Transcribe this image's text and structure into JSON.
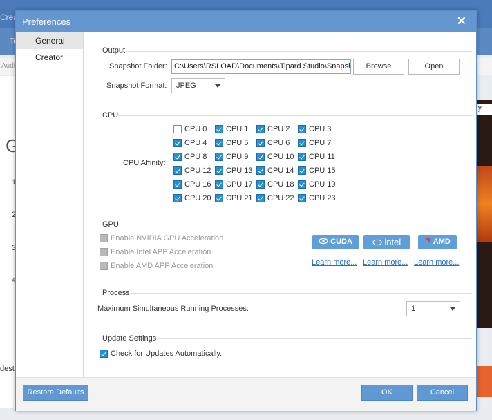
{
  "background": {
    "app_title_fragment": "Crea",
    "tab_fragment": "To",
    "toolbar_fragment": "Audi",
    "big_letter": "G",
    "list_numbers": [
      "1",
      "2",
      "3",
      "4"
    ],
    "right_fragment": "ry",
    "bottom_fragment": "desti"
  },
  "dialog": {
    "title": "Preferences",
    "close_glyph": "✕",
    "sidebar": [
      {
        "label": "General",
        "active": true
      },
      {
        "label": "Creator",
        "active": false
      }
    ],
    "output": {
      "section_title": "Output",
      "snapshot_folder_label": "Snapshot Folder:",
      "snapshot_folder_value": "C:\\Users\\RSLOAD\\Documents\\Tipard Studio\\Snapshot",
      "browse_label": "Browse",
      "open_label": "Open",
      "snapshot_format_label": "Snapshot Format:",
      "snapshot_format_value": "JPEG"
    },
    "cpu": {
      "section_title": "CPU",
      "affinity_label": "CPU Affinity:",
      "items": [
        {
          "label": "CPU 0",
          "checked": false
        },
        {
          "label": "CPU 1",
          "checked": true
        },
        {
          "label": "CPU 2",
          "checked": true
        },
        {
          "label": "CPU 3",
          "checked": true
        },
        {
          "label": "CPU 4",
          "checked": true
        },
        {
          "label": "CPU 5",
          "checked": true
        },
        {
          "label": "CPU 6",
          "checked": true
        },
        {
          "label": "CPU 7",
          "checked": true
        },
        {
          "label": "CPU 8",
          "checked": true
        },
        {
          "label": "CPU 9",
          "checked": true
        },
        {
          "label": "CPU 10",
          "checked": true
        },
        {
          "label": "CPU 11",
          "checked": true
        },
        {
          "label": "CPU 12",
          "checked": true
        },
        {
          "label": "CPU 13",
          "checked": true
        },
        {
          "label": "CPU 14",
          "checked": true
        },
        {
          "label": "CPU 15",
          "checked": true
        },
        {
          "label": "CPU 16",
          "checked": true
        },
        {
          "label": "CPU 17",
          "checked": true
        },
        {
          "label": "CPU 18",
          "checked": true
        },
        {
          "label": "CPU 19",
          "checked": true
        },
        {
          "label": "CPU 20",
          "checked": true
        },
        {
          "label": "CPU 21",
          "checked": true
        },
        {
          "label": "CPU 22",
          "checked": true
        },
        {
          "label": "CPU 23",
          "checked": true
        }
      ]
    },
    "gpu": {
      "section_title": "GPU",
      "options": [
        "Enable NVIDIA GPU Acceleration",
        "Enable Intel APP Acceleration",
        "Enable AMD APP Acceleration"
      ],
      "logos": [
        "CUDA",
        "intel",
        "AMD"
      ],
      "learn_more": [
        "Learn more...",
        "Learn more...",
        "Learn more..."
      ]
    },
    "process": {
      "section_title": "Process",
      "max_label": "Maximum Simultaneous Running Processes:",
      "max_value": "1"
    },
    "update": {
      "section_title": "Update Settings",
      "check_label": "Check for Updates Automatically.",
      "checked": true
    },
    "footer": {
      "restore_label": "Restore Defaults",
      "ok_label": "OK",
      "cancel_label": "Cancel"
    }
  }
}
